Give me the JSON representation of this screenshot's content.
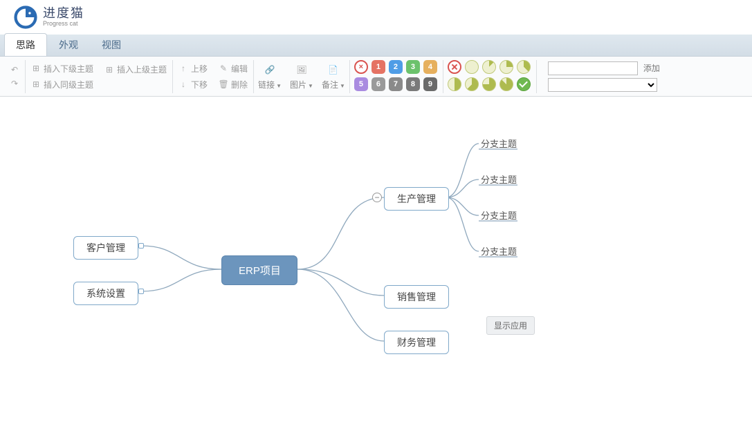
{
  "brand": {
    "cn": "进度猫",
    "en": "Progress cat"
  },
  "tabs": [
    {
      "label": "思路",
      "active": true
    },
    {
      "label": "外观",
      "active": false
    },
    {
      "label": "视图",
      "active": false
    }
  ],
  "toolbar": {
    "insert_child": "插入下级主题",
    "insert_parent": "插入上级主题",
    "insert_sibling": "插入同级主题",
    "move_up": "上移",
    "move_down": "下移",
    "edit": "编辑",
    "delete": "删除",
    "link": "链接",
    "image": "图片",
    "note": "备注"
  },
  "priorities": [
    {
      "label": "×",
      "color": "#e06666"
    },
    {
      "label": "1",
      "color": "#e57364"
    },
    {
      "label": "2",
      "color": "#4f9de6"
    },
    {
      "label": "3",
      "color": "#6cc26c"
    },
    {
      "label": "4",
      "color": "#e6b05e"
    },
    {
      "label": "5",
      "color": "#a98be0"
    },
    {
      "label": "6",
      "color": "#9a9a9a"
    },
    {
      "label": "7",
      "color": "#8a8a8a"
    },
    {
      "label": "8",
      "color": "#7a7a7a"
    },
    {
      "label": "9",
      "color": "#6a6a6a"
    }
  ],
  "progress_levels": [
    0,
    12,
    25,
    37,
    50,
    62,
    75,
    87
  ],
  "tag": {
    "add_label": "添加",
    "input_value": "",
    "select_value": ""
  },
  "mindmap": {
    "root": "ERP项目",
    "left": [
      {
        "label": "客户管理"
      },
      {
        "label": "系统设置"
      }
    ],
    "right": [
      {
        "label": "生产管理",
        "children": [
          "分支主题",
          "分支主题",
          "分支主题",
          "分支主题"
        ]
      },
      {
        "label": "销售管理"
      },
      {
        "label": "财务管理"
      }
    ]
  },
  "floating_button": "显示应用"
}
